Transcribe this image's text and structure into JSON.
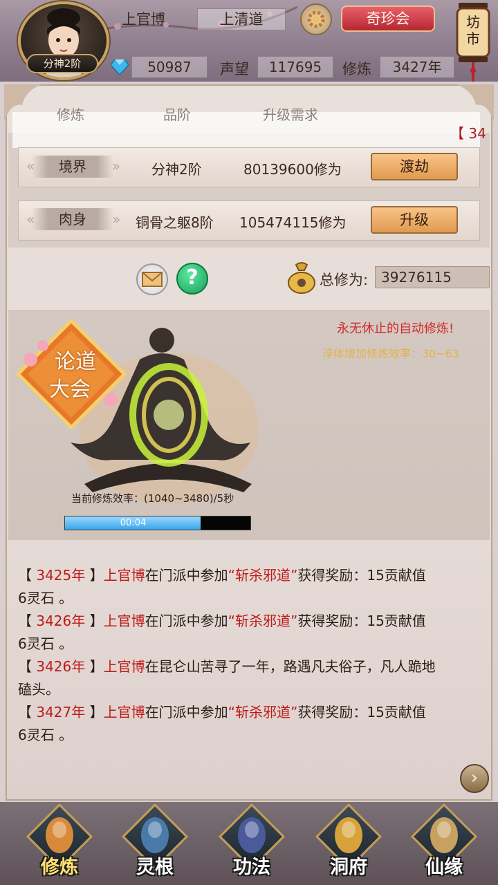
{
  "header": {
    "player_name": "上官博",
    "faction": "上清道",
    "avatar_rank": "分神2阶",
    "shop_button": "奇珍会",
    "market_label": "坊市",
    "gems": "50987",
    "reputation_label": "声望",
    "reputation": "117695",
    "cultivation_label": "修炼",
    "cultivation_years": "3427年"
  },
  "tabs": {
    "col1": "修炼",
    "col2": "品阶",
    "col3": "升级需求",
    "ticker": "【 34"
  },
  "rows": [
    {
      "tag": "境界",
      "rank": "分神2阶",
      "requirement": "80139600修为",
      "button": "渡劫"
    },
    {
      "tag": "肉身",
      "rank": "铜骨之躯8阶",
      "requirement": "105474115修为",
      "button": "升级"
    }
  ],
  "total": {
    "label": "总修为:",
    "value": "39276115"
  },
  "scene": {
    "badge_line1": "论道",
    "badge_line2": "大会",
    "auto_text": "永无休止的自动修炼!",
    "boost_text": "淬体增加修炼效率：30~63",
    "rate_text": "当前修炼效率：(1040~3480)/5秒",
    "timer": "00:04",
    "progress": 0.73
  },
  "log": [
    {
      "open": "【 ",
      "year": "3425年",
      "close": " 】",
      "name": "上官博",
      "mid": "在门派中参加",
      "event": "“斩杀邪道”",
      "tail": "获得奖励：15贡献值",
      "line2": "6灵石 。"
    },
    {
      "open": "【 ",
      "year": "3426年",
      "close": " 】",
      "name": "上官博",
      "mid": "在门派中参加",
      "event": "“斩杀邪道”",
      "tail": "获得奖励：15贡献值",
      "line2": "6灵石 。"
    },
    {
      "open": "【 ",
      "year": "3426年",
      "close": " 】",
      "name": "上官博",
      "mid": "在昆仑山苦寻了一年，路遇凡夫俗子，凡人跪地",
      "event": "",
      "tail": "",
      "line2": "磕头。"
    },
    {
      "open": "【 ",
      "year": "3427年",
      "close": " 】",
      "name": "上官博",
      "mid": "在门派中参加",
      "event": "“斩杀邪道”",
      "tail": "获得奖励：15贡献值",
      "line2": "6灵石 。"
    }
  ],
  "nav": [
    {
      "label": "修炼",
      "active": true
    },
    {
      "label": "灵根",
      "active": false
    },
    {
      "label": "功法",
      "active": false
    },
    {
      "label": "洞府",
      "active": false
    },
    {
      "label": "仙缘",
      "active": false
    }
  ],
  "colors": {
    "accent_red": "#c01818",
    "gold": "#e2b14a",
    "progress_fill": "#3aa6e8",
    "nav_active": "#ffe074"
  }
}
